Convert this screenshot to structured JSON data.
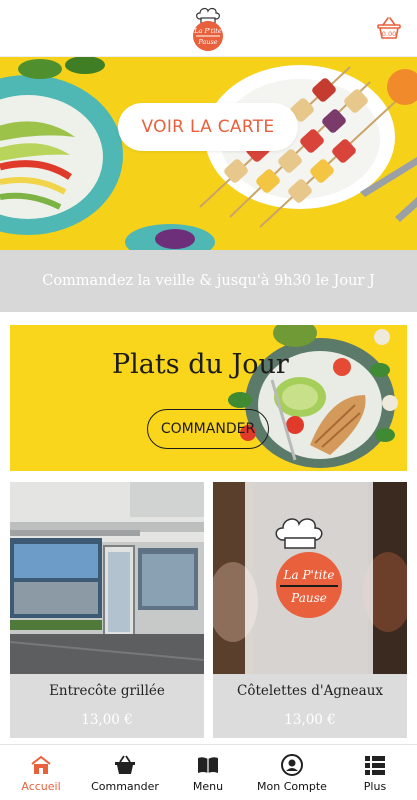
{
  "header": {
    "logo_line1": "La P'tite",
    "logo_line2": "Pause",
    "cart_icon": "basket-icon"
  },
  "hero": {
    "button_label": "VOIR LA CARTE"
  },
  "info_bar": {
    "text": "Commandez la veille & jusqu'à 9h30 le Jour J"
  },
  "plats": {
    "title": "Plats du Jour",
    "button_label": "COMMANDER"
  },
  "products": [
    {
      "name": "Entrecôte grillée",
      "price": "13,00 €"
    },
    {
      "name": "Côtelettes d'Agneaux",
      "price": "13,00 €",
      "logo_line1": "La P'tite",
      "logo_line2": "Pause"
    }
  ],
  "nav": {
    "items": [
      {
        "label": "Accueil",
        "icon": "home-icon"
      },
      {
        "label": "Commander",
        "icon": "basket-icon"
      },
      {
        "label": "Menu",
        "icon": "book-icon"
      },
      {
        "label": "Mon Compte",
        "icon": "user-icon"
      },
      {
        "label": "Plus",
        "icon": "list-icon"
      }
    ]
  },
  "colors": {
    "accent": "#e8603c",
    "hero_yellow": "#f6d11a",
    "info_gray": "#d8d8d8",
    "card_gray": "#dcdcdc"
  }
}
